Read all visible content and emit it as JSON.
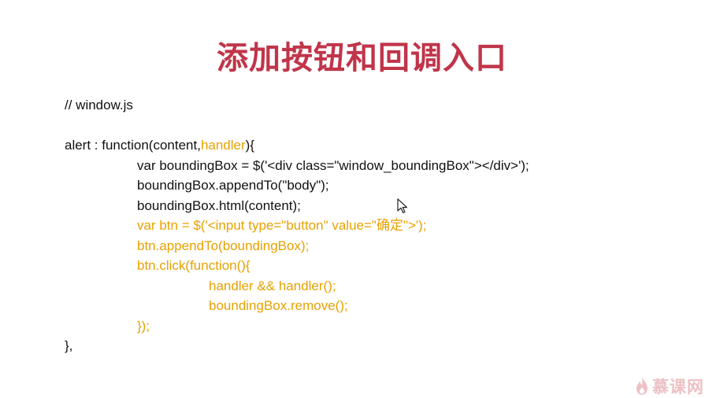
{
  "title": "添加按钮和回调入口",
  "code": {
    "comment": "// window.js",
    "alert_prefix": "alert : function(content,",
    "alert_handler": "handler",
    "alert_suffix": "){",
    "line_bbox": "var boundingBox = $('<div class=\"window_boundingBox\"></div>');",
    "line_append": "boundingBox.appendTo(\"body\");",
    "line_html": "boundingBox.html(content);",
    "line_btn": "var btn = $('<input type=\"button\" value=\"确定\">');",
    "line_btn_append": "btn.appendTo(boundingBox);",
    "line_btn_click": "btn.click(function(){",
    "line_handler_call": "handler && handler();",
    "line_remove": "boundingBox.remove();",
    "line_click_close": "});",
    "line_alert_close": "},"
  },
  "logo": {
    "text": "慕课网",
    "icon": "flame-icon"
  },
  "colors": {
    "title": "#c0354a",
    "highlight": "#e8a100",
    "code": "#111111",
    "logo": "#ecc1c5"
  }
}
